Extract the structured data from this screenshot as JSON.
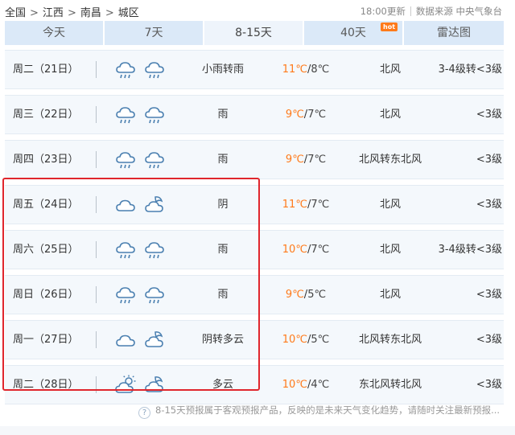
{
  "breadcrumb": {
    "items": [
      "全国",
      "江西",
      "南昌",
      "城区"
    ],
    "separator": ">"
  },
  "meta": {
    "update_time": "18:00更新",
    "source": "数据来源 中央气象台"
  },
  "tabs": [
    {
      "label": "今天",
      "active": false,
      "badge": ""
    },
    {
      "label": "7天",
      "active": false,
      "badge": ""
    },
    {
      "label": "8-15天",
      "active": true,
      "badge": ""
    },
    {
      "label": "40天",
      "active": false,
      "badge": "hot"
    },
    {
      "label": "雷达图",
      "active": false,
      "badge": ""
    }
  ],
  "forecast": [
    {
      "date": "周二（21日）",
      "icon_day": "rain-cloud-icon",
      "icon_night": "rain-cloud-icon",
      "desc": "小雨转雨",
      "high": "11℃",
      "low": "8℃",
      "wind": "北风",
      "level": "3-4级转<3级"
    },
    {
      "date": "周三（22日）",
      "icon_day": "rain-cloud-icon",
      "icon_night": "rain-cloud-icon",
      "desc": "雨",
      "high": "9℃",
      "low": "7℃",
      "wind": "北风",
      "level": "<3级"
    },
    {
      "date": "周四（23日）",
      "icon_day": "rain-cloud-icon",
      "icon_night": "rain-cloud-icon",
      "desc": "雨",
      "high": "9℃",
      "low": "7℃",
      "wind": "北风转东北风",
      "level": "<3级"
    },
    {
      "date": "周五（24日）",
      "icon_day": "cloud-icon",
      "icon_night": "moon-cloud-icon",
      "desc": "阴",
      "high": "11℃",
      "low": "7℃",
      "wind": "北风",
      "level": "<3级"
    },
    {
      "date": "周六（25日）",
      "icon_day": "rain-cloud-icon",
      "icon_night": "rain-cloud-icon",
      "desc": "雨",
      "high": "10℃",
      "low": "7℃",
      "wind": "北风",
      "level": "3-4级转<3级"
    },
    {
      "date": "周日（26日）",
      "icon_day": "rain-cloud-icon",
      "icon_night": "rain-cloud-icon",
      "desc": "雨",
      "high": "9℃",
      "low": "5℃",
      "wind": "北风",
      "level": "<3级"
    },
    {
      "date": "周一（27日）",
      "icon_day": "cloud-icon",
      "icon_night": "moon-cloud-icon",
      "desc": "阴转多云",
      "high": "10℃",
      "low": "5℃",
      "wind": "北风转东北风",
      "level": "<3级"
    },
    {
      "date": "周二（28日）",
      "icon_day": "sun-cloud-icon",
      "icon_night": "moon-cloud-icon",
      "desc": "多云",
      "high": "10℃",
      "low": "4℃",
      "wind": "东北风转北风",
      "level": "<3级"
    }
  ],
  "footer_note": "8-15天预报属于客观预报产品，反映的是未来天气变化趋势，请随时关注最新预报...",
  "colors": {
    "accent_temp": "#ff7a1a",
    "highlight_border": "#e0262d",
    "tab_bg": "#dbe9f8",
    "row_bg": "#f4f8fc",
    "icon_stroke": "#4a7fb0"
  }
}
